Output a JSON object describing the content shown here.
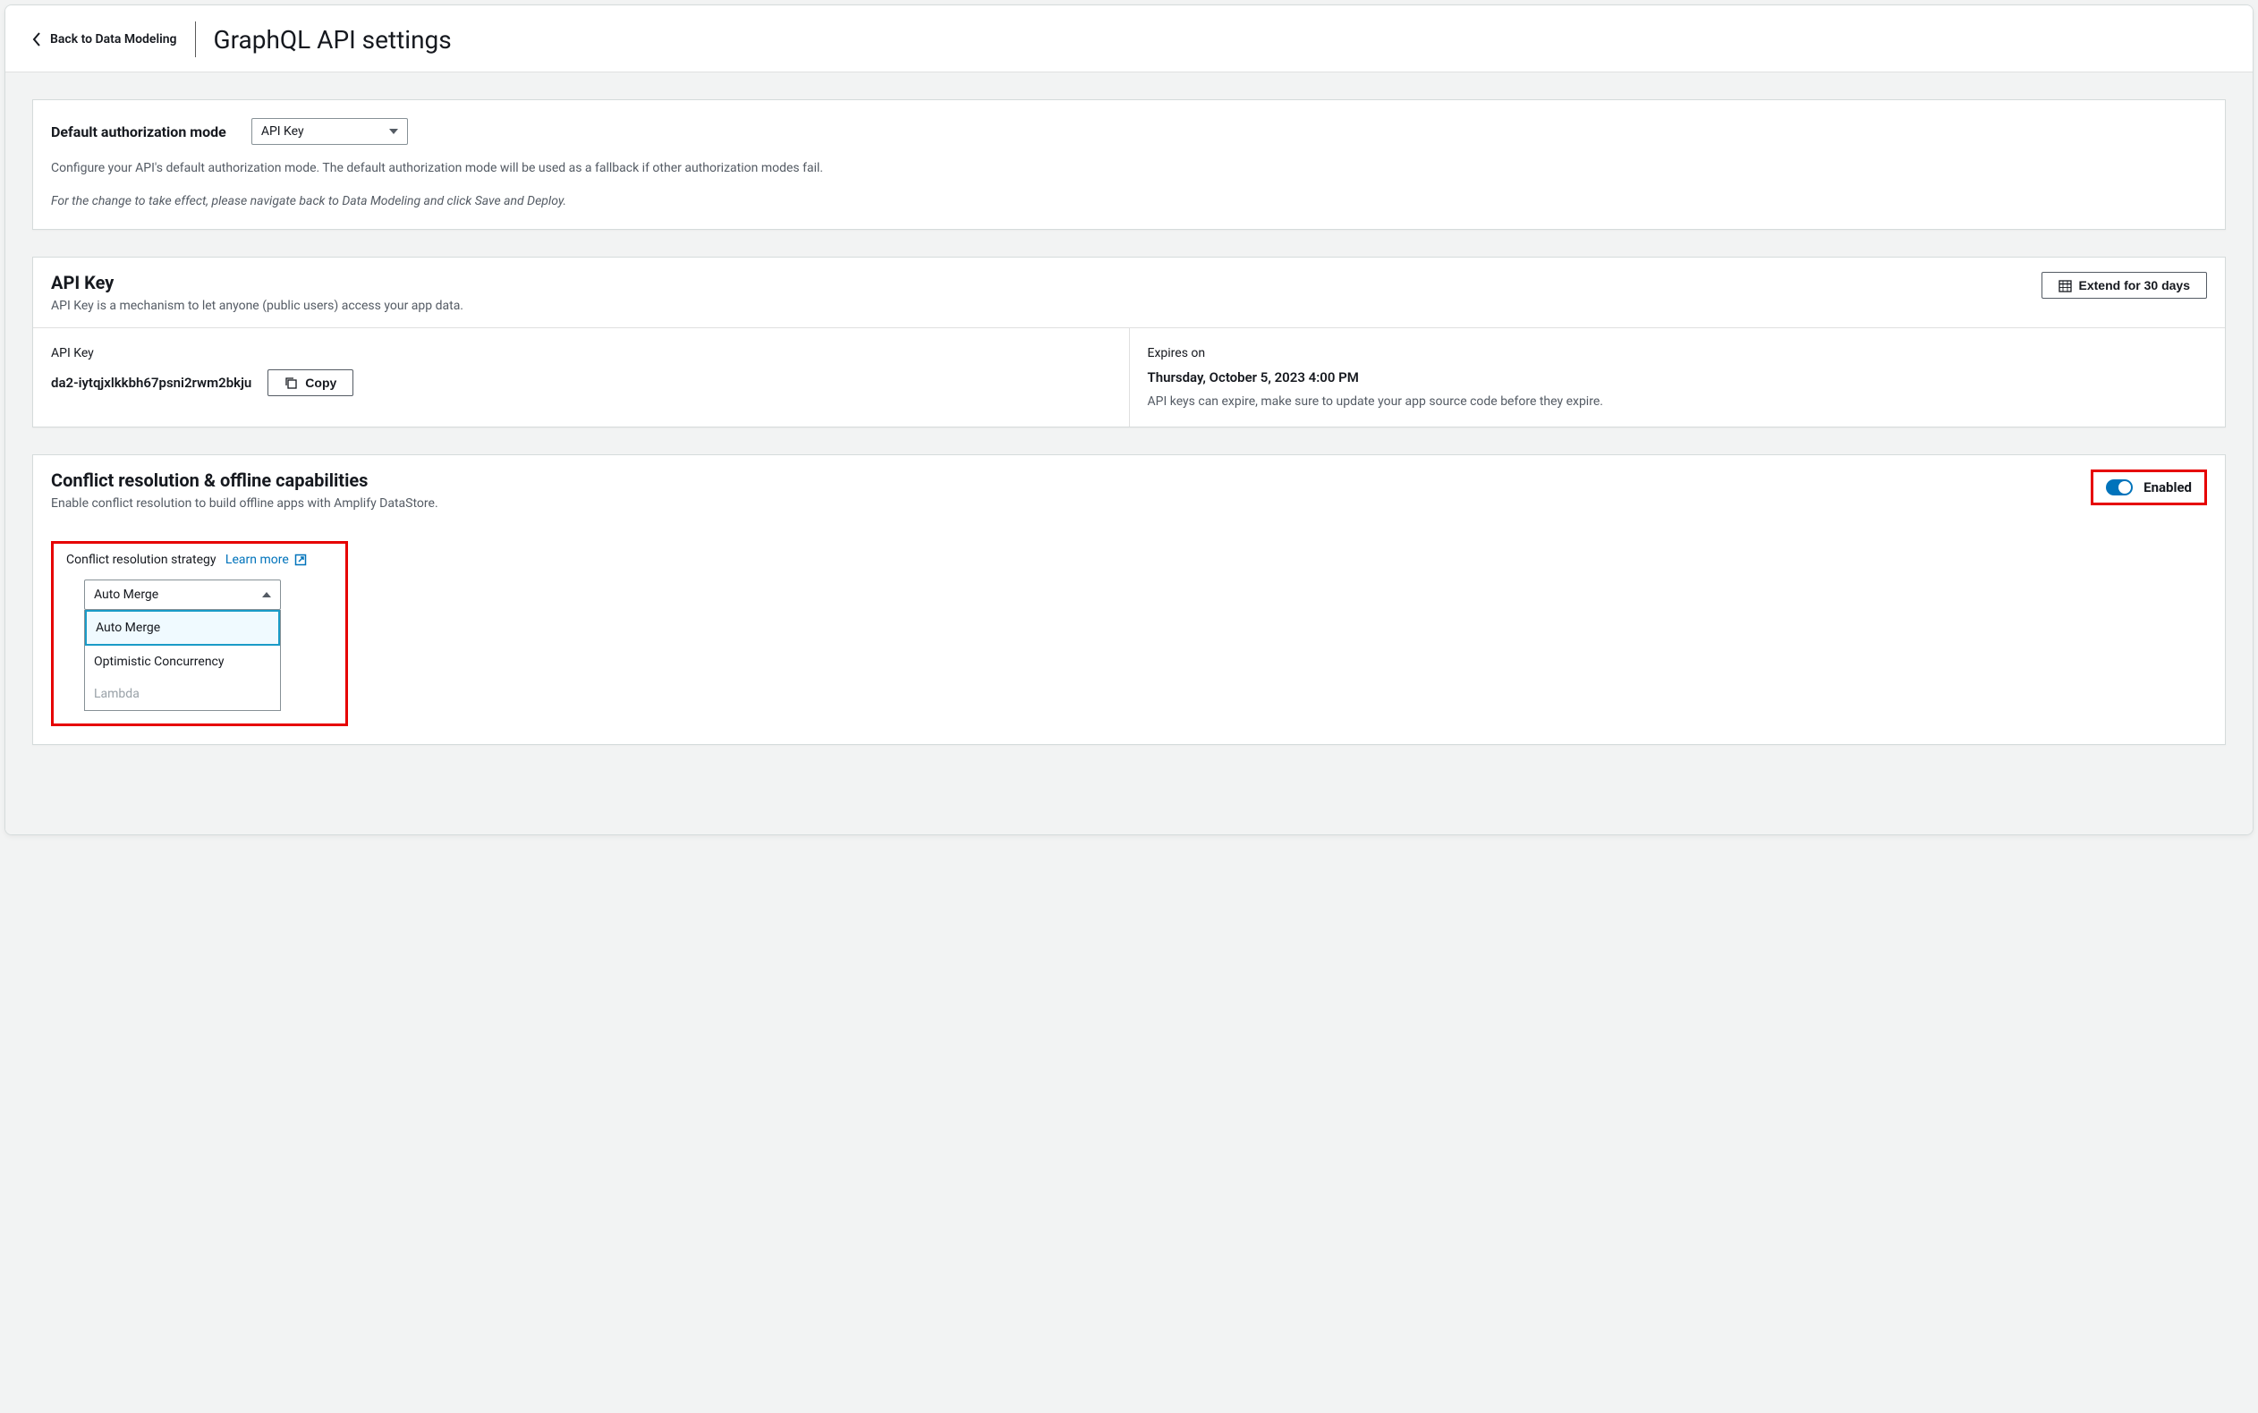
{
  "header": {
    "back_label": "Back to Data Modeling",
    "page_title": "GraphQL API settings"
  },
  "auth_panel": {
    "label": "Default authorization mode",
    "select_value": "API Key",
    "description": "Configure your API's default authorization mode. The default authorization mode will be used as a fallback if other authorization modes fail.",
    "note": "For the change to take effect, please navigate back to Data Modeling and click Save and Deploy."
  },
  "api_key_panel": {
    "title": "API Key",
    "subtitle": "API Key is a mechanism to let anyone (public users) access your app data.",
    "extend_btn": "Extend for 30 days",
    "key_label": "API Key",
    "key_value": "da2-iytqjxlkkbh67psni2rwm2bkju",
    "copy_btn": "Copy",
    "expires_label": "Expires on",
    "expires_value": "Thursday, October 5, 2023 4:00 PM",
    "expires_hint": "API keys can expire, make sure to update your app source code before they expire."
  },
  "conflict_panel": {
    "title": "Conflict resolution & offline capabilities",
    "subtitle": "Enable conflict resolution to build offline apps with Amplify DataStore.",
    "enabled_label": "Enabled",
    "strategy_label": "Conflict resolution strategy",
    "learn_more": "Learn more",
    "selected": "Auto Merge",
    "options": [
      "Auto Merge",
      "Optimistic Concurrency",
      "Lambda"
    ]
  }
}
